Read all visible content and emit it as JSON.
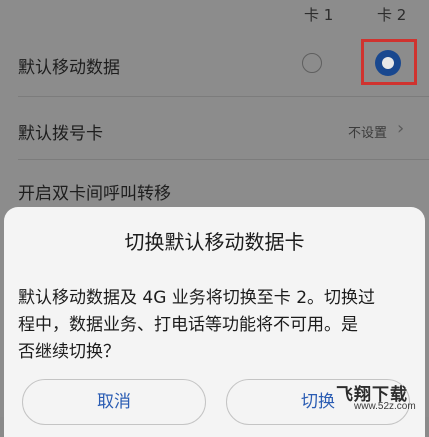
{
  "columns": {
    "card1": "卡 1",
    "card2": "卡 2"
  },
  "rows": {
    "default_mobile_data": {
      "title": "默认移动数据",
      "selected": "卡 2"
    },
    "default_dial_card": {
      "title": "默认拨号卡",
      "value": "不设置"
    },
    "dual_call_forward": {
      "title": "开启双卡间呼叫转移"
    }
  },
  "dialog": {
    "title": "切换默认移动数据卡",
    "body_lines": [
      "默认移动数据及 4G 业务将切换至卡 2。切换过",
      "程中，数据业务、打电话等功能将不可用。是",
      "否继续切换？"
    ],
    "cancel_label": "取消",
    "confirm_label": "切换"
  },
  "watermark": {
    "main": "飞翔下载",
    "sub": "www.52z.com"
  },
  "colors": {
    "highlight": "#d0332f",
    "accent": "#2a5cb3",
    "radio_selected": "#19488f"
  },
  "icons": {
    "chevron": "chevron-right-icon",
    "radio_empty": "radio-unchecked-icon",
    "radio_checked": "radio-checked-icon"
  }
}
